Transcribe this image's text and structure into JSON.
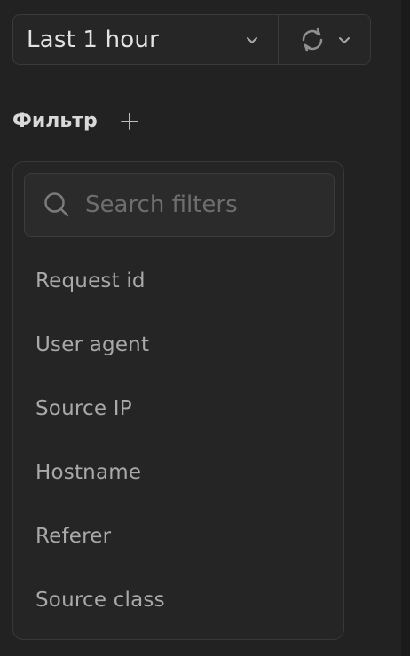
{
  "time_range": {
    "selected": "Last 1 hour",
    "chevron_icon": "chevron-down-icon",
    "refresh_icon": "refresh-icon"
  },
  "filter": {
    "title": "Фильтр",
    "add_icon": "plus-icon"
  },
  "filter_dropdown": {
    "search": {
      "placeholder": "Search filters",
      "value": "",
      "icon": "search-icon"
    },
    "options": [
      {
        "label": "Request id"
      },
      {
        "label": "User agent"
      },
      {
        "label": "Source IP"
      },
      {
        "label": "Hostname"
      },
      {
        "label": "Referer"
      },
      {
        "label": "Source class"
      }
    ]
  },
  "colors": {
    "background": "#222222",
    "panel": "#252525",
    "border": "#383838",
    "text_primary": "#e2e2e2",
    "text_muted": "#a9a9a9",
    "placeholder": "#6e6e6e"
  }
}
